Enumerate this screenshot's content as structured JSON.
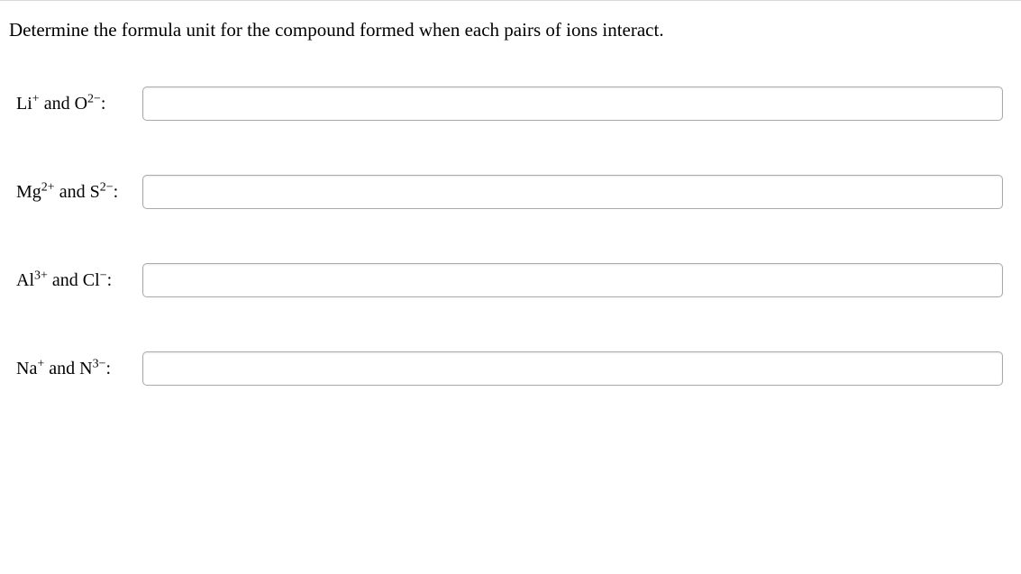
{
  "question": "Determine the formula unit for the compound formed when each pairs of ions interact.",
  "rows": [
    {
      "label_html": "Li<sup>+</sup> and O<sup>2−</sup>:",
      "value": ""
    },
    {
      "label_html": "Mg<sup>2+</sup> and S<sup>2−</sup>:",
      "value": ""
    },
    {
      "label_html": "Al<sup>3+</sup> and Cl<sup>−</sup>:",
      "value": ""
    },
    {
      "label_html": "Na<sup>+</sup> and N<sup>3−</sup>:",
      "value": ""
    }
  ]
}
